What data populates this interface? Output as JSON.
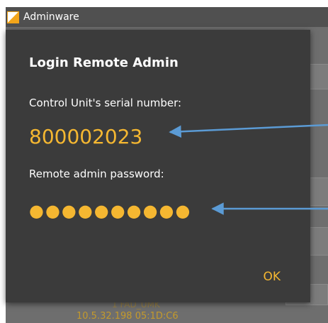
{
  "app": {
    "title": "Adminware",
    "background_device_name": "1 FAD_UMK",
    "background_device_info": "10.5.32.198  05:1D:C6"
  },
  "dialog": {
    "title": "Login Remote Admin",
    "serial_label": "Control Unit's serial number:",
    "serial_value": "800002023",
    "password_label": "Remote admin password:",
    "password_mask": "●●●●●●●●●●",
    "ok_label": "OK"
  },
  "colors": {
    "accent": "#f5b731",
    "dialog_bg": "#3b3b3b",
    "arrow": "#5b9bd5"
  }
}
